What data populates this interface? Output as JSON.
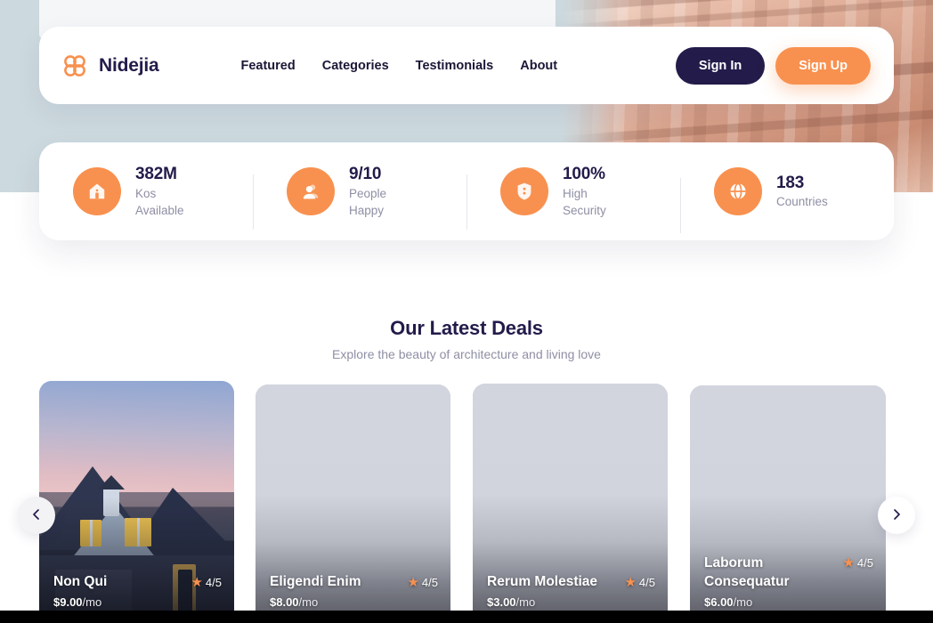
{
  "brand": {
    "name": "Nidejia",
    "logo_icon": "clover-logo-icon",
    "accent_color": "#f8914f",
    "dark_color": "#231b4a"
  },
  "nav": {
    "links": [
      {
        "label": "Featured"
      },
      {
        "label": "Categories"
      },
      {
        "label": "Testimonials"
      },
      {
        "label": "About"
      }
    ],
    "sign_in_label": "Sign In",
    "sign_up_label": "Sign Up"
  },
  "stats": [
    {
      "value": "382M",
      "label": "Kos\nAvailable",
      "label_line1": "Kos",
      "label_line2": "Available",
      "icon": "home-icon"
    },
    {
      "value": "9/10",
      "label": "People\nHappy",
      "label_line1": "People",
      "label_line2": "Happy",
      "icon": "people-icon"
    },
    {
      "value": "100%",
      "label": "High\nSecurity",
      "label_line1": "High",
      "label_line2": "Security",
      "icon": "shield-icon"
    },
    {
      "value": "183",
      "label": "Countries",
      "label_line1": "Countries",
      "label_line2": "",
      "icon": "globe-icon"
    }
  ],
  "deals": {
    "title": "Our Latest Deals",
    "subtitle": "Explore the beauty of architecture and living love",
    "prev_icon": "chevron-left-icon",
    "next_icon": "chevron-right-icon",
    "cards": [
      {
        "title": "Non Qui",
        "price": "$9.00",
        "price_unit": "/mo",
        "rating": "4/5",
        "star_icon": "star-icon",
        "media": "photo"
      },
      {
        "title": "Eligendi Enim",
        "price": "$8.00",
        "price_unit": "/mo",
        "rating": "4/5",
        "star_icon": "star-icon",
        "media": "placeholder"
      },
      {
        "title": "Rerum Molestiae",
        "price": "$3.00",
        "price_unit": "/mo",
        "rating": "4/5",
        "star_icon": "star-icon",
        "media": "placeholder"
      },
      {
        "title": "Laborum Consequatur",
        "price": "$6.00",
        "price_unit": "/mo",
        "rating": "4/5",
        "star_icon": "star-icon",
        "media": "placeholder"
      }
    ]
  }
}
